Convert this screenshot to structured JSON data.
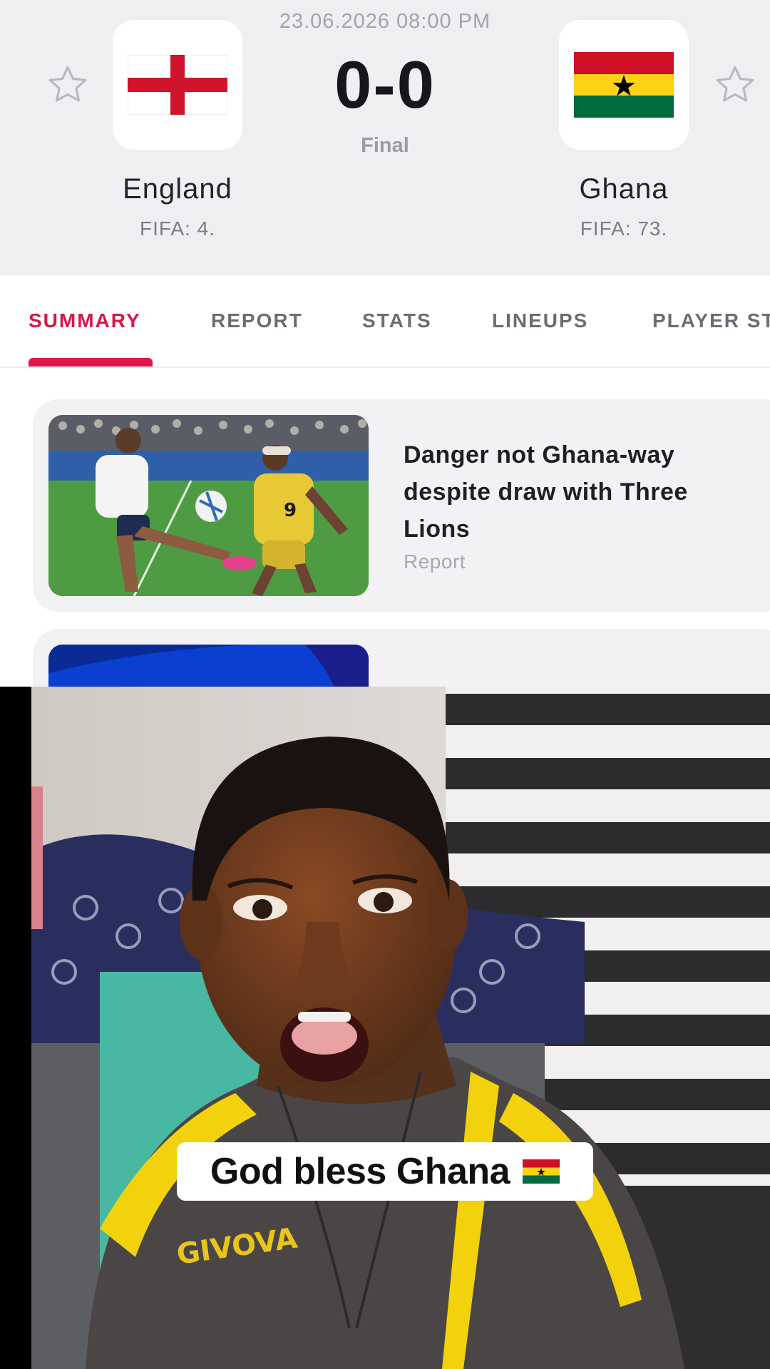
{
  "match": {
    "datetime": "23.06.2026 08:00 PM",
    "score": "0-0",
    "status": "Final",
    "home_team": {
      "name": "England",
      "rank": "FIFA: 4.",
      "flag_icon": "england-flag-icon"
    },
    "away_team": {
      "name": "Ghana",
      "rank": "FIFA: 73.",
      "flag_icon": "ghana-flag-icon"
    }
  },
  "tabs": [
    {
      "label": "SUMMARY",
      "active": true
    },
    {
      "label": "REPORT",
      "active": false
    },
    {
      "label": "STATS",
      "active": false
    },
    {
      "label": "LINEUPS",
      "active": false
    },
    {
      "label": "PLAYER ST",
      "active": false
    }
  ],
  "news": [
    {
      "title": "Danger not Ghana-way despite draw with Three Lions",
      "type": "Report"
    }
  ],
  "video": {
    "caption": "God bless Ghana",
    "caption_emoji": "ghana-flag-icon"
  },
  "colors": {
    "accent": "#e0174c",
    "header_bg": "#efeff1",
    "ghana_red": "#ce1126",
    "ghana_yellow": "#fcd116",
    "ghana_green": "#006b3f"
  }
}
